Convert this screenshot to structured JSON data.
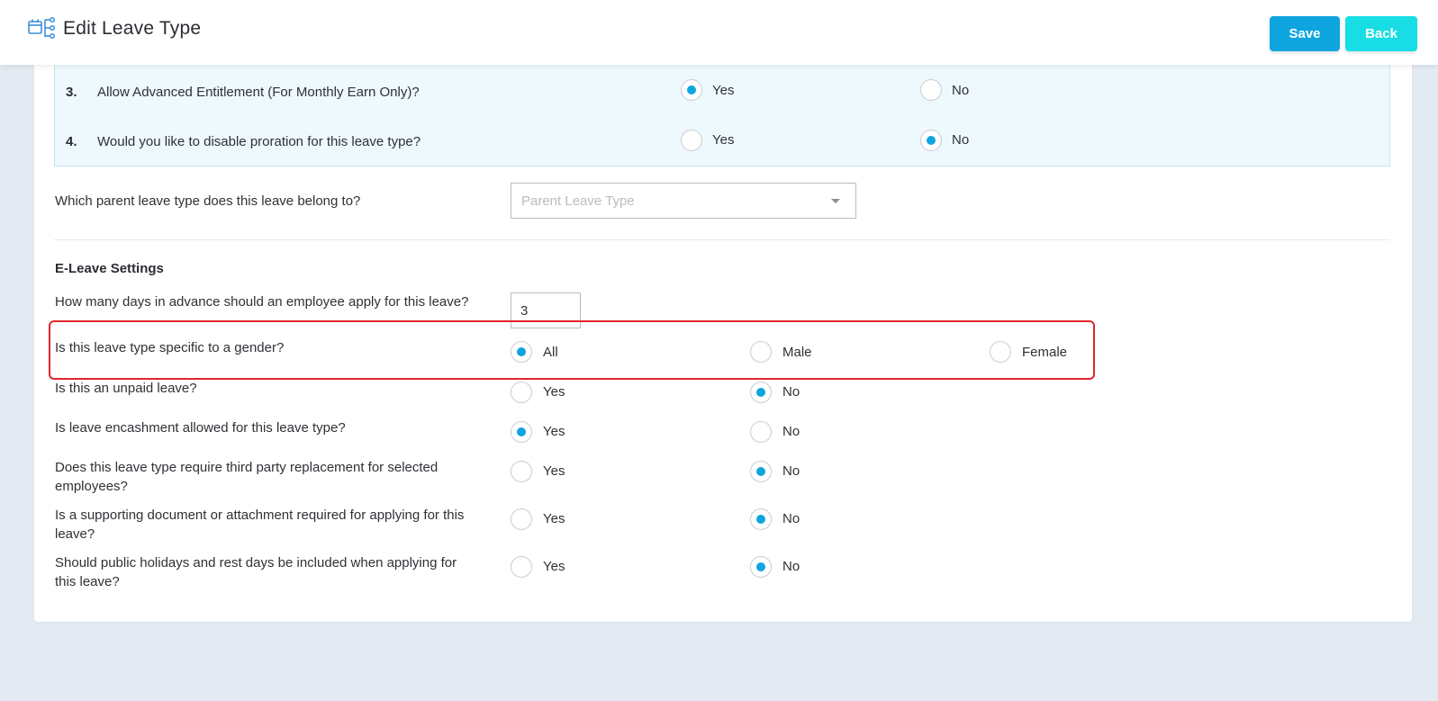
{
  "header": {
    "title": "Edit Leave Type",
    "icon": "hierarchy-calendar-icon",
    "save_label": "Save",
    "back_label": "Back"
  },
  "colors": {
    "accent": "#0ea5de",
    "back_button": "#18dde4",
    "highlight_border": "#e0262b",
    "panel_bg": "#eef9fe"
  },
  "numbered_questions": [
    {
      "num": "3.",
      "text": "Allow Advanced Entitlement (For Monthly Earn Only)?",
      "options": [
        "Yes",
        "No"
      ],
      "selected": "Yes"
    },
    {
      "num": "4.",
      "text": "Would you like to disable proration for this leave type?",
      "options": [
        "Yes",
        "No"
      ],
      "selected": "No"
    }
  ],
  "parent": {
    "label": "Which parent leave type does this leave belong to?",
    "placeholder": "Parent Leave Type"
  },
  "eleave": {
    "section_title": "E-Leave Settings",
    "advance_days_label": "How many days in advance should an employee apply for this leave?",
    "advance_days_value": "3",
    "gender": {
      "label": "Is this leave type specific to a gender?",
      "options": [
        "All",
        "Male",
        "Female"
      ],
      "selected": "All"
    },
    "questions": [
      {
        "text": "Is this an unpaid leave?",
        "options": [
          "Yes",
          "No"
        ],
        "selected": "No"
      },
      {
        "text": "Is leave encashment allowed for this leave type?",
        "options": [
          "Yes",
          "No"
        ],
        "selected": "Yes"
      },
      {
        "text": "Does this leave type require third party replacement for selected employees?",
        "options": [
          "Yes",
          "No"
        ],
        "selected": "No"
      },
      {
        "text": "Is a supporting document or attachment required for applying for this leave?",
        "options": [
          "Yes",
          "No"
        ],
        "selected": "No"
      },
      {
        "text": "Should public holidays and rest days be included when applying for this leave?",
        "options": [
          "Yes",
          "No"
        ],
        "selected": "No"
      }
    ]
  }
}
